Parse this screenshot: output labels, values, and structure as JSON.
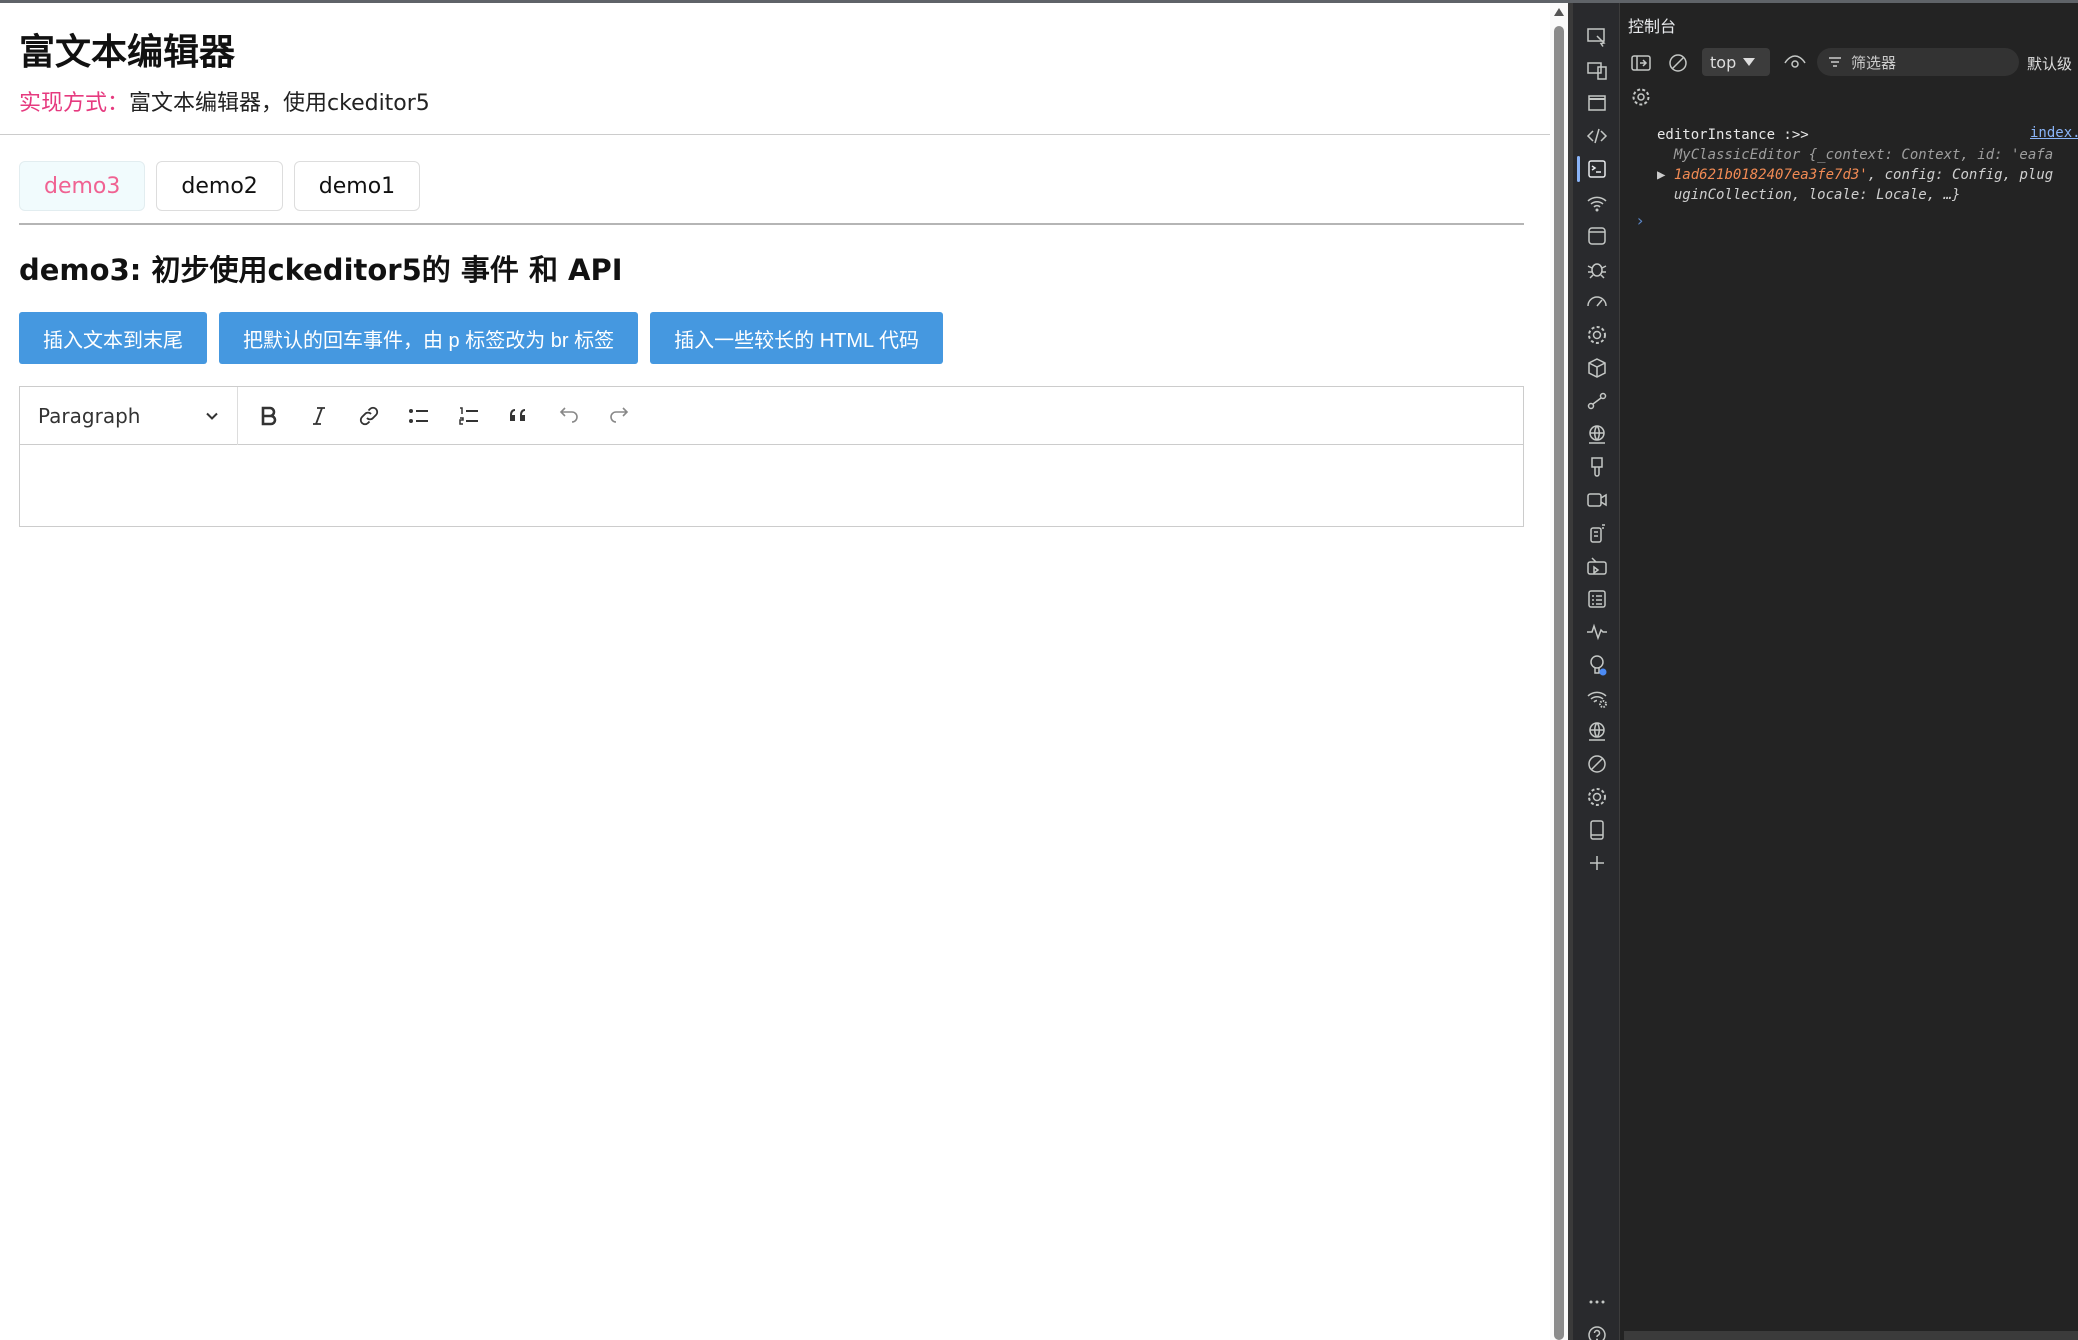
{
  "page": {
    "title": "富文本编辑器",
    "impl_key": "实现方式：",
    "impl_value": "富文本编辑器，使用ckeditor5",
    "tabs": [
      {
        "label": "demo3",
        "active": true
      },
      {
        "label": "demo2",
        "active": false
      },
      {
        "label": "demo1",
        "active": false
      }
    ],
    "section_title": "demo3: 初步使用ckeditor5的 事件 和 API",
    "buttons": [
      "插入文本到末尾",
      "把默认的回车事件，由 p 标签改为 br 标签",
      "插入一些较长的 HTML 代码"
    ],
    "editor": {
      "paragraph_label": "Paragraph",
      "tools": [
        "bold-icon",
        "italic-icon",
        "link-icon",
        "bulleted-list-icon",
        "numbered-list-icon",
        "block-quote-icon",
        "undo-icon",
        "redo-icon"
      ],
      "content": ""
    }
  },
  "devtools": {
    "title": "控制台",
    "context": "top",
    "filter_placeholder": "筛选器",
    "default_levels": "默认级",
    "log": {
      "label": "editorInstance :>>",
      "line1": "MyClassicEditor {_context: Context, id: 'eafa",
      "line2_str": "1ad621b0182407ea3fe7d3'",
      "line2_rest": ", config: Config, plug",
      "line3": "uginCollection, locale: Locale, …}",
      "source": "index."
    },
    "rail_icons": [
      "inspect-icon",
      "device-icon",
      "elements-window-icon",
      "sources-code-icon",
      "console-icon",
      "network-wifi-icon",
      "application-icon",
      "debug-bug-icon",
      "performance-icon",
      "settings-gear-icon",
      "box-icon",
      "recorder-icon",
      "network-globe-icon",
      "paint-brush-icon",
      "video-icon",
      "memory-icon",
      "media-icon",
      "issues-list-icon",
      "activity-icon",
      "lighthouse-icon",
      "network-conditions-icon",
      "globe-icon",
      "block-icon",
      "sensors-gear-icon",
      "device-mode-icon",
      "add-icon"
    ]
  },
  "colors": {
    "accent_pink": "#e63a7f",
    "button_blue": "#4598e0",
    "devtools_bg": "#232323"
  }
}
